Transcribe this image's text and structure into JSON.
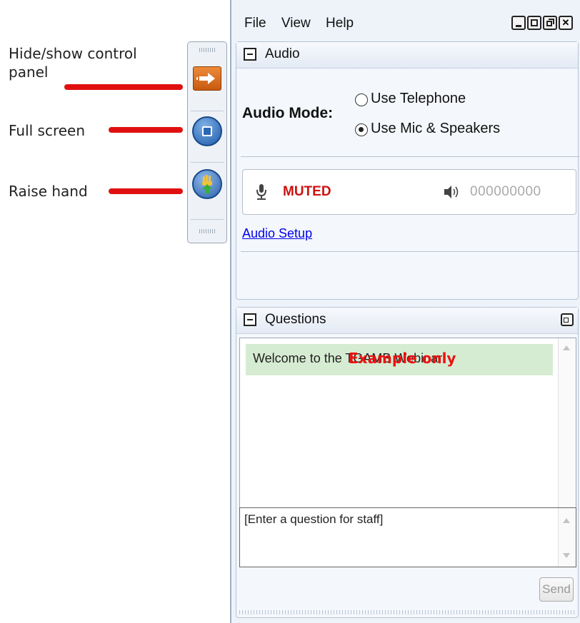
{
  "annotations": {
    "hide_show": "Hide/show control panel",
    "full_screen": "Full screen",
    "raise_hand": "Raise hand"
  },
  "menu": {
    "file": "File",
    "view": "View",
    "help": "Help"
  },
  "window_controls": [
    "minimize-icon",
    "maximize-icon",
    "restore-icon",
    "close-icon"
  ],
  "audio": {
    "title": "Audio",
    "mode_label": "Audio Mode:",
    "options": [
      {
        "label": "Use Telephone",
        "selected": false
      },
      {
        "label": "Use Mic & Speakers",
        "selected": true
      }
    ],
    "mic_status": "MUTED",
    "speaker_level": "000000000",
    "setup_link": "Audio Setup"
  },
  "questions": {
    "title": "Questions",
    "message": "Welcome to the TGAMB Webinar",
    "watermark": "Example only",
    "input_placeholder": "[Enter a question for staff]",
    "send_label": "Send"
  },
  "colors": {
    "accent": "#e01010",
    "muted": "#cc1111",
    "highlight": "#d6ecd2",
    "link": "#0000ee"
  }
}
